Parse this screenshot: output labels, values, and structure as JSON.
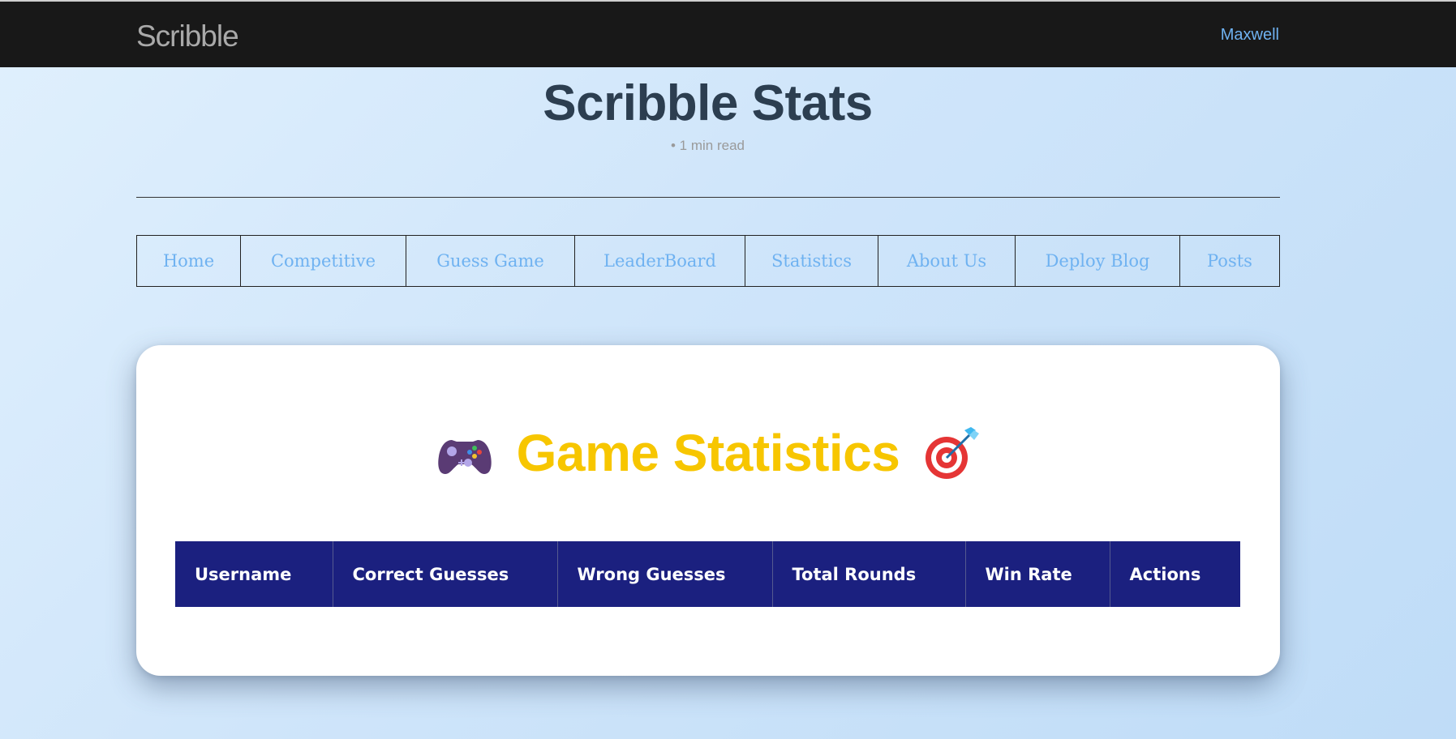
{
  "navbar": {
    "brand": "Scribble",
    "user": "Maxwell"
  },
  "page": {
    "title": "Scribble Stats",
    "read_time": "• 1 min read"
  },
  "menu": {
    "items": [
      {
        "label": "Home"
      },
      {
        "label": "Competitive"
      },
      {
        "label": "Guess Game"
      },
      {
        "label": "LeaderBoard"
      },
      {
        "label": "Statistics"
      },
      {
        "label": "About Us"
      },
      {
        "label": "Deploy Blog"
      },
      {
        "label": "Posts"
      }
    ]
  },
  "stats": {
    "title": "Game Statistics",
    "left_icon": "game-controller-icon",
    "right_icon": "direct-hit-target-icon",
    "columns": [
      "Username",
      "Correct Guesses",
      "Wrong Guesses",
      "Total Rounds",
      "Win Rate",
      "Actions"
    ],
    "rows": []
  },
  "colors": {
    "navbar_bg": "#181818",
    "link": "#6fb2f1",
    "title": "#2c3e50",
    "stats_title": "#f7c600",
    "table_header_bg": "#1b207f"
  }
}
